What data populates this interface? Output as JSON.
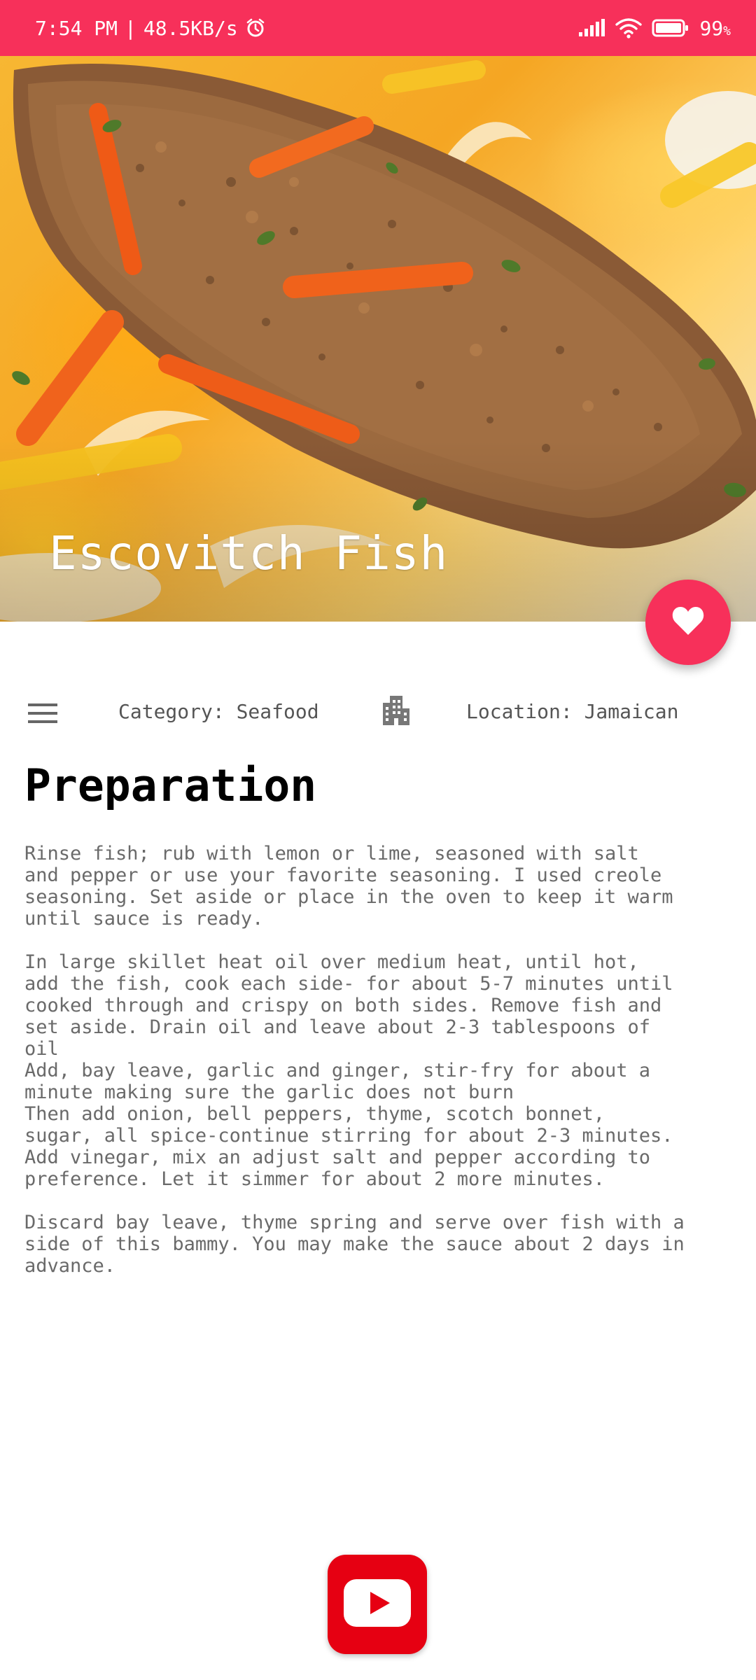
{
  "status_bar": {
    "time": "7:54 PM",
    "separator": "|",
    "network_speed": "48.5KB/s",
    "battery_percent": "99",
    "battery_unit": "%",
    "icons": [
      "alarm-icon",
      "signal-icon",
      "wifi-icon",
      "battery-icon"
    ]
  },
  "recipe": {
    "title": "Escovitch Fish",
    "category_text": "Category: Seafood",
    "location_text": "Location: Jamaican",
    "section_heading": "Preparation",
    "instructions": "Rinse fish; rub with lemon or lime, seasoned with salt\nand pepper or use your favorite seasoning. I used creole\nseasoning. Set aside or place in the oven to keep it warm\nuntil sauce is ready.\n\nIn large skillet heat oil over medium heat, until hot,\nadd the fish, cook each side- for about 5-7 minutes until\ncooked through and crispy on both sides. Remove fish and\nset aside. Drain oil and leave about 2-3 tablespoons of\noil\nAdd, bay leave, garlic and ginger, stir-fry for about a\nminute making sure the garlic does not burn\nThen add onion, bell peppers, thyme, scotch bonnet,\nsugar, all spice-continue stirring for about 2-3 minutes.\nAdd vinegar, mix an adjust salt and pepper according to\npreference. Let it simmer for about 2 more minutes.\n\nDiscard bay leave, thyme spring and serve over fish with a\nside of this bammy. You may make the sauce about 2 days in\nadvance."
  },
  "colors": {
    "accent": "#f7305a",
    "youtube_red": "#e60012",
    "body_text": "#6a6a6a",
    "meta_text": "#555555"
  },
  "icons": {
    "favorite": "heart-icon",
    "category": "menu-icon",
    "location": "building-icon",
    "video": "youtube-icon"
  }
}
